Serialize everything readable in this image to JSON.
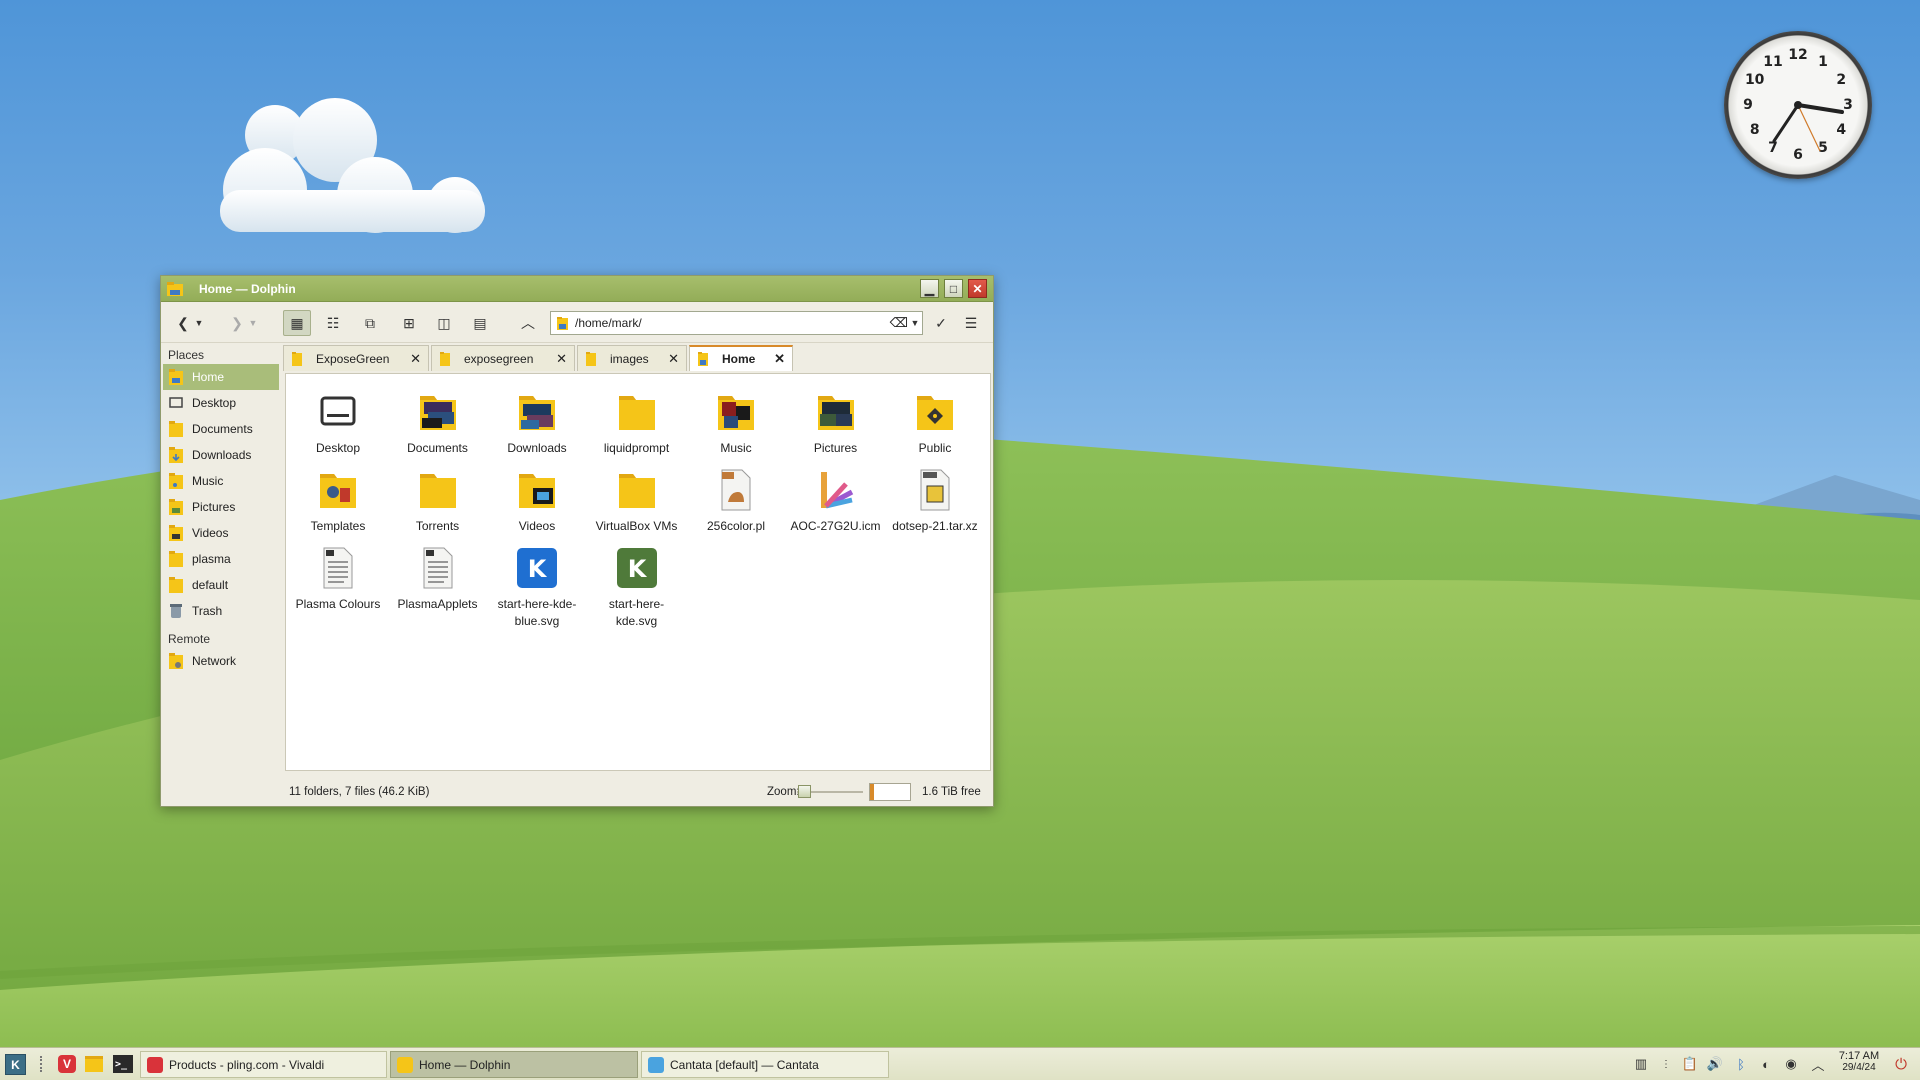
{
  "window": {
    "title": "Home — Dolphin",
    "location_path": "/home/mark/",
    "sidebar": {
      "places_heading": "Places",
      "places": [
        {
          "label": "Home",
          "icon": "home-folder-icon",
          "selected": true
        },
        {
          "label": "Desktop",
          "icon": "desktop-icon"
        },
        {
          "label": "Documents",
          "icon": "documents-folder-icon"
        },
        {
          "label": "Downloads",
          "icon": "downloads-folder-icon"
        },
        {
          "label": "Music",
          "icon": "music-folder-icon"
        },
        {
          "label": "Pictures",
          "icon": "pictures-folder-icon"
        },
        {
          "label": "Videos",
          "icon": "videos-folder-icon"
        },
        {
          "label": "plasma",
          "icon": "folder-icon"
        },
        {
          "label": "default",
          "icon": "folder-icon"
        },
        {
          "label": "Trash",
          "icon": "trash-icon"
        }
      ],
      "remote_heading": "Remote",
      "remote": [
        {
          "label": "Network",
          "icon": "network-folder-icon"
        }
      ]
    },
    "tabs": [
      {
        "label": "ExposeGreen",
        "active": false
      },
      {
        "label": "exposegreen",
        "active": false
      },
      {
        "label": "images",
        "active": false
      },
      {
        "label": "Home",
        "active": true
      }
    ],
    "files": [
      {
        "name": "Desktop",
        "icon": "desktop-icon"
      },
      {
        "name": "Documents",
        "icon": "documents-folder-icon"
      },
      {
        "name": "Downloads",
        "icon": "downloads-folder-icon"
      },
      {
        "name": "liquidprompt",
        "icon": "folder-icon"
      },
      {
        "name": "Music",
        "icon": "music-folder-icon"
      },
      {
        "name": "Pictures",
        "icon": "pictures-folder-icon"
      },
      {
        "name": "Public",
        "icon": "public-folder-icon"
      },
      {
        "name": "Templates",
        "icon": "templates-folder-icon"
      },
      {
        "name": "Torrents",
        "icon": "folder-icon"
      },
      {
        "name": "Videos",
        "icon": "videos-folder-icon"
      },
      {
        "name": "VirtualBox VMs",
        "icon": "folder-icon"
      },
      {
        "name": "256color.pl",
        "icon": "perl-file-icon"
      },
      {
        "name": "AOC-27G2U.icm",
        "icon": "color-profile-icon"
      },
      {
        "name": "dotsep-21.tar.xz",
        "icon": "archive-icon"
      },
      {
        "name": "Plasma Colours",
        "icon": "text-file-icon"
      },
      {
        "name": "PlasmaApplets",
        "icon": "text-file-icon"
      },
      {
        "name": "start-here-kde-blue.svg",
        "icon": "kde-blue-icon"
      },
      {
        "name": "start-here-kde.svg",
        "icon": "kde-green-icon"
      }
    ],
    "status": {
      "summary": "11 folders, 7 files (46.2 KiB)",
      "zoom_label": "Zoom:",
      "free_space": "1.6 TiB free",
      "zoom_level": 0.08
    }
  },
  "taskbar": {
    "tasks": [
      {
        "label": "Products - pling.com - Vivaldi",
        "icon": "vivaldi-icon",
        "active": false
      },
      {
        "label": "Home — Dolphin",
        "icon": "dolphin-icon",
        "active": true
      },
      {
        "label": "Cantata [default] — Cantata",
        "icon": "cantata-icon",
        "active": false
      }
    ],
    "clock_time": "7:17 AM",
    "clock_date": "29/4/24"
  },
  "clock_widget": {
    "numbers": [
      "12",
      "1",
      "2",
      "3",
      "4",
      "5",
      "6",
      "7",
      "8",
      "9",
      "10",
      "11"
    ]
  },
  "colors": {
    "titlebar": "#9db462",
    "selection": "#a9bd7a",
    "active_tab_accent": "#d88a2a",
    "folder": "#f5c518"
  }
}
